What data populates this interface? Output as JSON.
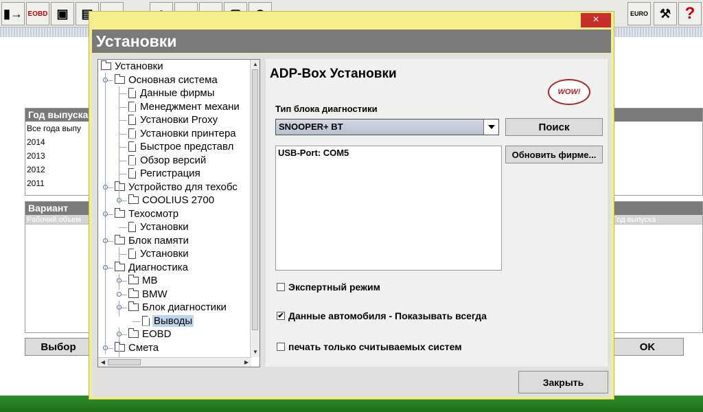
{
  "background": {
    "toolbar_left": [
      {
        "name": "exit-icon",
        "label": "▮→"
      },
      {
        "name": "eobd-icon",
        "label": "EOBD"
      },
      {
        "name": "monitor-icon",
        "label": "▣"
      },
      {
        "name": "document-icon",
        "label": "▤"
      },
      {
        "name": "circle-icon",
        "label": "●"
      },
      {
        "name": "people-icon",
        "label": "♣"
      },
      {
        "name": "car-icon",
        "label": "▭"
      },
      {
        "name": "gauge-icon",
        "label": "◔"
      },
      {
        "name": "frame-icon",
        "label": "▢"
      },
      {
        "name": "clock-icon",
        "label": "◷"
      }
    ],
    "toolbar_right": [
      {
        "name": "euro-car-icon",
        "label": "EURO"
      },
      {
        "name": "tool-icon",
        "label": "⚒"
      },
      {
        "name": "help-icon",
        "label": "?"
      }
    ],
    "year_panel_title": "Год выпуска",
    "year_items": [
      "Все года выпу",
      "2014",
      "2013",
      "2012",
      "2011"
    ],
    "variant_panel_title": "Вариант",
    "variant_column": "Рабочий объем",
    "right_column": "Год выпуска",
    "select_button": "Выбор",
    "ok_button": "OK"
  },
  "dialog": {
    "close_label": "×",
    "title": "Установки",
    "tree": [
      {
        "label": "Установки",
        "type": "folder",
        "level": 0
      },
      {
        "label": "Основная система",
        "type": "folder",
        "level": 1
      },
      {
        "label": "Данные фирмы",
        "type": "doc",
        "level": 2
      },
      {
        "label": "Менеджмент механи",
        "type": "doc",
        "level": 2
      },
      {
        "label": "Установки Proxy",
        "type": "doc",
        "level": 2
      },
      {
        "label": "Установки принтера",
        "type": "doc",
        "level": 2
      },
      {
        "label": "Быстрое представл",
        "type": "doc",
        "level": 2
      },
      {
        "label": "Обзор версий",
        "type": "doc",
        "level": 2
      },
      {
        "label": "Регистрация",
        "type": "doc",
        "level": 2
      },
      {
        "label": "Устройство для техобс",
        "type": "folder",
        "level": 1
      },
      {
        "label": "COOLIUS 2700",
        "type": "folder",
        "level": 2
      },
      {
        "label": "Техосмотр",
        "type": "folder",
        "level": 1
      },
      {
        "label": "Установки",
        "type": "doc",
        "level": 2
      },
      {
        "label": "Блок памяти",
        "type": "folder",
        "level": 1
      },
      {
        "label": "Установки",
        "type": "doc",
        "level": 2
      },
      {
        "label": "Диагностика",
        "type": "folder",
        "level": 1
      },
      {
        "label": "MB",
        "type": "folder",
        "level": 2
      },
      {
        "label": "BMW",
        "type": "folder",
        "level": 2
      },
      {
        "label": "Блок диагностики",
        "type": "folder",
        "level": 2
      },
      {
        "label": "Выводы",
        "type": "doc",
        "level": 3,
        "selected": true
      },
      {
        "label": "EOBD",
        "type": "folder",
        "level": 2
      },
      {
        "label": "Смета",
        "type": "folder",
        "level": 1
      }
    ],
    "settings": {
      "heading": "ADP-Box Установки",
      "logo_text": "WOW!",
      "device_type_label": "Тип блока диагностики",
      "device_type_value": "SNOOPER+ BT",
      "search_button": "Поиск",
      "port_text": "USB-Port: COM5",
      "update_button": "Обновить фирме...",
      "expert_mode": {
        "label": "Экспертный режим",
        "checked": false
      },
      "vehicle_data": {
        "label": "Данные автомобиля - Показывать всегда",
        "checked": true
      },
      "print_only": {
        "label": "печать только считываемых систем",
        "checked": false
      }
    },
    "close_button": "Закрыть"
  }
}
